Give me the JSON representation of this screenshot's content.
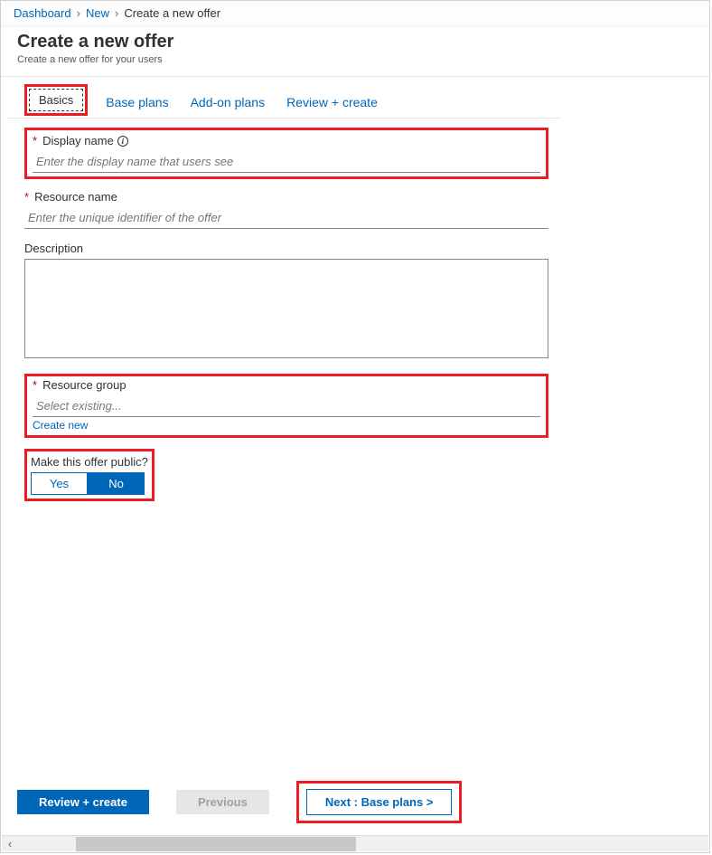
{
  "breadcrumb": {
    "items": [
      "Dashboard",
      "New",
      "Create a new offer"
    ]
  },
  "title": {
    "heading": "Create a new offer",
    "subtitle": "Create a new offer for your users"
  },
  "tabs": [
    "Basics",
    "Base plans",
    "Add-on plans",
    "Review + create"
  ],
  "fields": {
    "displayName": {
      "label": "Display name",
      "placeholder": "Enter the display name that users see",
      "required": true
    },
    "resourceName": {
      "label": "Resource name",
      "placeholder": "Enter the unique identifier of the offer",
      "required": true
    },
    "description": {
      "label": "Description"
    },
    "resourceGroup": {
      "label": "Resource group",
      "placeholder": "Select existing...",
      "required": true,
      "createNew": "Create new"
    },
    "makePublic": {
      "label": "Make this offer public?",
      "yes": "Yes",
      "no": "No"
    }
  },
  "footer": {
    "review": "Review + create",
    "previous": "Previous",
    "next": "Next : Base plans >"
  }
}
